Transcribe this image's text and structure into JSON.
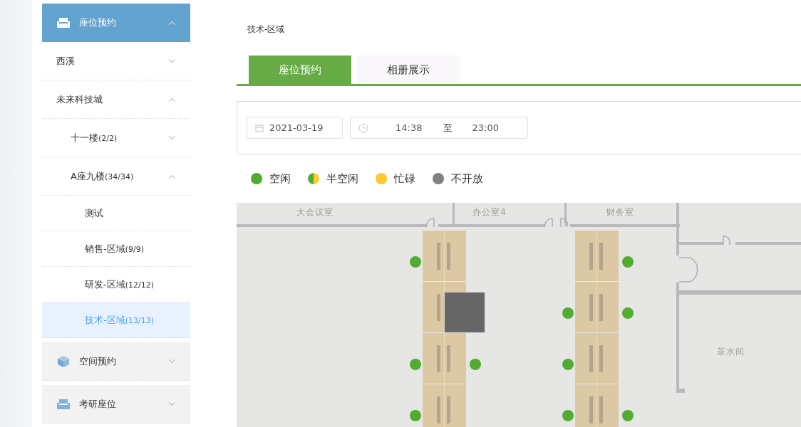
{
  "sidebar": {
    "items": [
      {
        "label": "座位预约",
        "kind": "section",
        "expanded": true,
        "children": [
          {
            "label": "西溪",
            "expanded": false
          },
          {
            "label": "未来科技城",
            "expanded": true,
            "children": [
              {
                "label": "十一楼",
                "count": "(2/2)",
                "expanded": false
              },
              {
                "label": "A座九楼",
                "count": "(34/34)",
                "expanded": true,
                "children": [
                  {
                    "label": "测试",
                    "selected": false
                  },
                  {
                    "label": "销售-区域",
                    "count": "(9/9)",
                    "selected": false
                  },
                  {
                    "label": "研发-区域",
                    "count": "(12/12)",
                    "selected": false
                  },
                  {
                    "label": "技术-区域",
                    "count": "(13/13)",
                    "selected": true
                  }
                ]
              }
            ]
          }
        ]
      },
      {
        "label": "空间预约",
        "kind": "section",
        "expanded": false
      },
      {
        "label": "考研座位",
        "kind": "section",
        "expanded": false
      }
    ]
  },
  "breadcrumb": "技术-区域",
  "tabs": [
    {
      "label": "座位预约",
      "selected": true
    },
    {
      "label": "相册展示",
      "selected": false
    }
  ],
  "filter": {
    "date": "2021-03-19",
    "time_start": "14:38",
    "time_separator": "至",
    "time_end": "23:00"
  },
  "legend": [
    {
      "label": "空闲",
      "kind": "solid",
      "color": "#52ac32"
    },
    {
      "label": "半空闲",
      "kind": "split",
      "color": "#52ac32"
    },
    {
      "label": "忙碌",
      "kind": "solid",
      "color": "#fdc931"
    },
    {
      "label": "不开放",
      "kind": "solid",
      "color": "#808080"
    }
  ],
  "floor_plan": {
    "rooms": [
      "大会议室",
      "办公室4",
      "财务室",
      "茶水间"
    ],
    "desk_columns": [
      {
        "desks": [
          {
            "left_free": true,
            "right_free": false,
            "blocked": false
          },
          {
            "left_free": false,
            "right_free": false,
            "blocked": true
          },
          {
            "left_free": true,
            "right_free": true,
            "blocked": false
          },
          {
            "left_free": true,
            "right_free": false,
            "blocked": false
          }
        ]
      },
      {
        "desks": [
          {
            "left_free": false,
            "right_free": true,
            "blocked": false
          },
          {
            "left_free": true,
            "right_free": true,
            "blocked": false
          },
          {
            "left_free": true,
            "right_free": false,
            "blocked": false
          },
          {
            "left_free": true,
            "right_free": true,
            "blocked": false
          }
        ]
      }
    ]
  }
}
